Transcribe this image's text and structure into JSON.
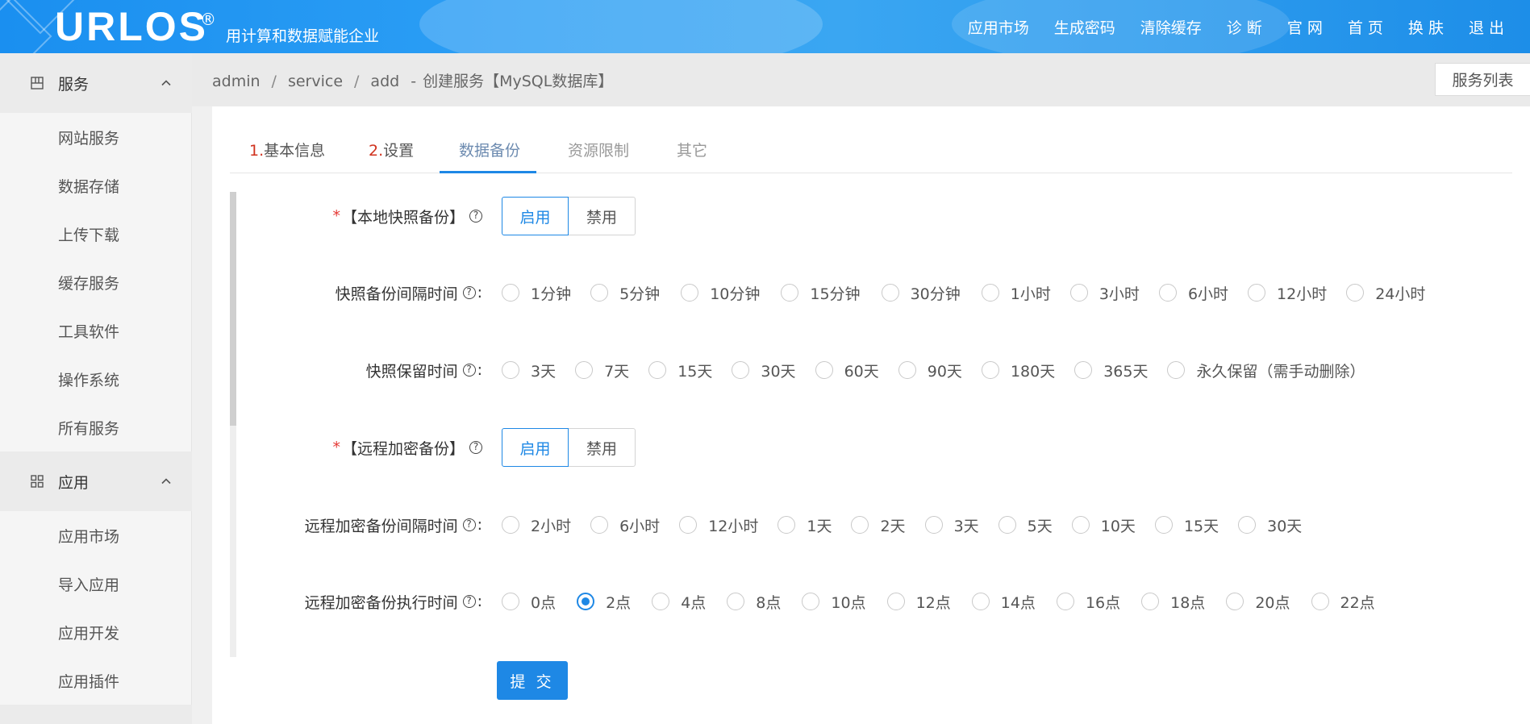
{
  "header": {
    "logo": "URLOS",
    "logo_reg": "®",
    "slogan": "用计算和数据赋能企业",
    "nav": [
      "应用市场",
      "生成密码",
      "清除缓存",
      "诊 断",
      "官 网",
      "首 页",
      "换 肤",
      "退 出"
    ]
  },
  "sidebar": {
    "group1": {
      "label": "服务",
      "icon": "server-icon"
    },
    "group1_items": [
      "网站服务",
      "数据存储",
      "上传下载",
      "缓存服务",
      "工具软件",
      "操作系统",
      "所有服务"
    ],
    "group2": {
      "label": "应用",
      "icon": "grid-icon"
    },
    "group2_items": [
      "应用市场",
      "导入应用",
      "应用开发",
      "应用插件"
    ]
  },
  "breadcrumb": {
    "p1": "admin",
    "p2": "service",
    "p3": "add",
    "dash": "-",
    "title": "创建服务【MySQL数据库】"
  },
  "service_list_button": "服务列表",
  "tabs": [
    {
      "num": "1.",
      "label": "基本信息"
    },
    {
      "num": "2.",
      "label": "设置"
    },
    {
      "num": "",
      "label": "数据备份"
    },
    {
      "num": "",
      "label": "资源限制"
    },
    {
      "num": "",
      "label": "其它"
    }
  ],
  "form": {
    "local_snapshot": {
      "label": "【本地快照备份】",
      "required": "*",
      "options": [
        "启用",
        "禁用"
      ],
      "selected": "启用"
    },
    "snapshot_interval": {
      "label": "快照备份间隔时间",
      "colon": ":",
      "options": [
        "1分钟",
        "5分钟",
        "10分钟",
        "15分钟",
        "30分钟",
        "1小时",
        "3小时",
        "6小时",
        "12小时",
        "24小时"
      ]
    },
    "snapshot_retention": {
      "label": "快照保留时间",
      "colon": ":",
      "options": [
        "3天",
        "7天",
        "15天",
        "30天",
        "60天",
        "90天",
        "180天",
        "365天",
        "永久保留（需手动删除）"
      ]
    },
    "remote_backup": {
      "label": "【远程加密备份】",
      "required": "*",
      "options": [
        "启用",
        "禁用"
      ],
      "selected": "启用"
    },
    "remote_interval": {
      "label": "远程加密备份间隔时间",
      "colon": ":",
      "options": [
        "2小时",
        "6小时",
        "12小时",
        "1天",
        "2天",
        "3天",
        "5天",
        "10天",
        "15天",
        "30天"
      ]
    },
    "remote_exec_time": {
      "label": "远程加密备份执行时间",
      "colon": ":",
      "options": [
        "0点",
        "2点",
        "4点",
        "8点",
        "10点",
        "12点",
        "14点",
        "16点",
        "18点",
        "20点",
        "22点"
      ],
      "selected": "2点"
    },
    "help_glyph": "?",
    "submit": "提 交"
  },
  "colors": {
    "accent": "#1e88e5",
    "required": "#e53935",
    "tab_num": "#d0321e"
  }
}
